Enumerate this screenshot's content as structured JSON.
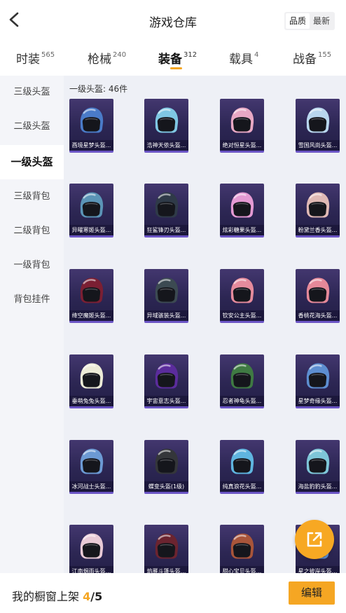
{
  "header": {
    "title": "游戏仓库",
    "toggle": [
      "品质",
      "最新"
    ],
    "toggle_active": 0
  },
  "tabs": [
    {
      "label": "时装",
      "count": "565"
    },
    {
      "label": "枪械",
      "count": "240"
    },
    {
      "label": "装备",
      "count": "312",
      "active": true
    },
    {
      "label": "载具",
      "count": "4"
    },
    {
      "label": "战备",
      "count": "155"
    }
  ],
  "sidebar": {
    "items": [
      "三级头盔",
      "二级头盔",
      "一级头盔",
      "三级背包",
      "二级背包",
      "一级背包",
      "背包挂件"
    ],
    "active_index": 2
  },
  "section": {
    "title": "一级头盔: 46件"
  },
  "items": [
    {
      "name": "酉境星梦头盔...",
      "color": "#4a7bc8"
    },
    {
      "name": "浩神天依头盔...",
      "color": "#7fc7e3"
    },
    {
      "name": "绝对恒星头盔...",
      "color": "#e8a8c4"
    },
    {
      "name": "雪国风尚头盔...",
      "color": "#b8d6ee"
    },
    {
      "name": "异曜寒姬头盔...",
      "color": "#5b94b6"
    },
    {
      "name": "狂鲨锋刃头盔...",
      "color": "#2f3a48"
    },
    {
      "name": "炫彩糖果头盔...",
      "color": "#e49ad3"
    },
    {
      "name": "粉黛兰香头盔...",
      "color": "#dfb9b5"
    },
    {
      "name": "绛空魔姬头盔...",
      "color": "#7b1f33"
    },
    {
      "name": "异域骇装头盔...",
      "color": "#3c4a52"
    },
    {
      "name": "钦安公主头盔...",
      "color": "#e58b9c"
    },
    {
      "name": "香桃花海头盔...",
      "color": "#e58999"
    },
    {
      "name": "垂萌兔兔头盔...",
      "color": "#ecebd7"
    },
    {
      "name": "宇宙意志头盔...",
      "color": "#5b2c9c"
    },
    {
      "name": "忍者神龟头盔...",
      "color": "#3f7a43"
    },
    {
      "name": "星梦奇缘头盔...",
      "color": "#5d8ed0"
    },
    {
      "name": "冰河战士头盔...",
      "color": "#6c9ad4"
    },
    {
      "name": "蝶变头盔(1级)",
      "color": "#34363a"
    },
    {
      "name": "纯真浪花头盔...",
      "color": "#5fb5e0"
    },
    {
      "name": "海盐豹豹头盔...",
      "color": "#7ec6d8"
    },
    {
      "name": "江南烟雨头盔...",
      "color": "#e8cad6"
    },
    {
      "name": "焰雁斗篷头盔...",
      "color": "#6b2430"
    },
    {
      "name": "甜心宝贝头盔...",
      "color": "#a8553a"
    },
    {
      "name": "星之彼岸头盔...",
      "color": "#5e8fd2"
    }
  ],
  "bottom": {
    "shelf_label": "我的橱窗上架",
    "shelf_current": "4",
    "shelf_total": "/5",
    "edit_label": "编辑"
  },
  "colors": {
    "accent": "#f5a623",
    "card_bg": "#2c2653",
    "card_border": "#6b55c5"
  }
}
